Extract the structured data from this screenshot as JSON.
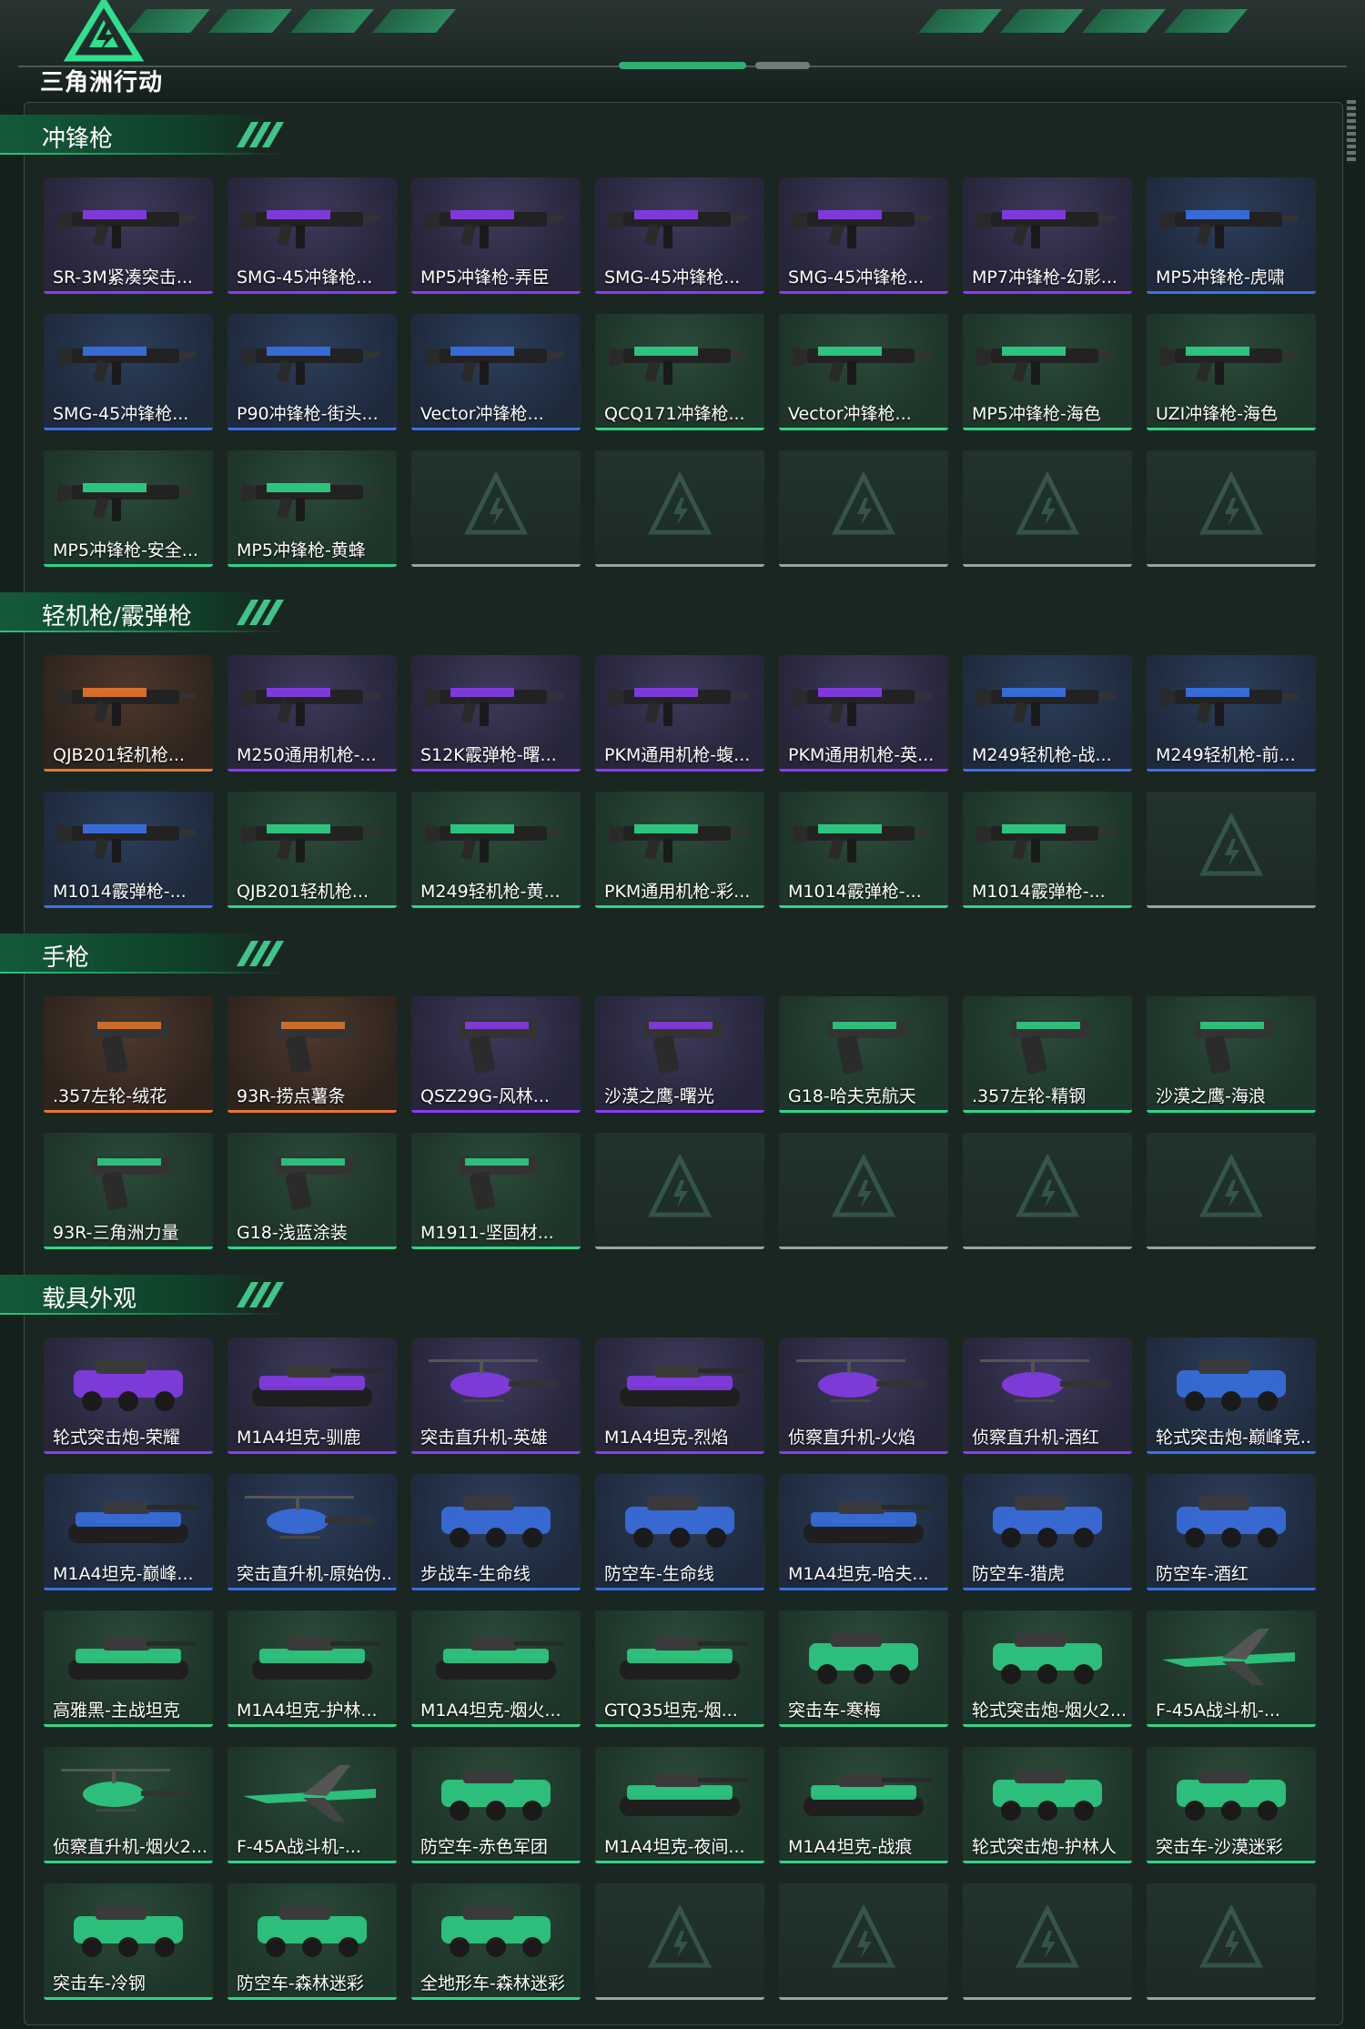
{
  "app": {
    "logo_text": "三角洲行动"
  },
  "colors": {
    "purple": "#8a3cf0",
    "blue": "#3a72e8",
    "green": "#2ed587",
    "orange": "#e8772a",
    "empty": "#9aa39f"
  },
  "sections": [
    {
      "title": "冲锋枪",
      "items": [
        {
          "name": "SR-3M紧凑突击...",
          "rarity": "purple",
          "type": "gun"
        },
        {
          "name": "SMG-45冲锋枪...",
          "rarity": "purple",
          "type": "gun"
        },
        {
          "name": "MP5冲锋枪-弄臣",
          "rarity": "purple",
          "type": "gun"
        },
        {
          "name": "SMG-45冲锋枪...",
          "rarity": "purple",
          "type": "gun"
        },
        {
          "name": "SMG-45冲锋枪...",
          "rarity": "purple",
          "type": "gun"
        },
        {
          "name": "MP7冲锋枪-幻影...",
          "rarity": "purple",
          "type": "gun"
        },
        {
          "name": "MP5冲锋枪-虎啸",
          "rarity": "blue",
          "type": "gun"
        },
        {
          "name": "SMG-45冲锋枪...",
          "rarity": "blue",
          "type": "gun"
        },
        {
          "name": "P90冲锋枪-街头...",
          "rarity": "blue",
          "type": "gun"
        },
        {
          "name": "Vector冲锋枪...",
          "rarity": "blue",
          "type": "gun"
        },
        {
          "name": "QCQ171冲锋枪...",
          "rarity": "green",
          "type": "gun"
        },
        {
          "name": "Vector冲锋枪...",
          "rarity": "green",
          "type": "gun"
        },
        {
          "name": "MP5冲锋枪-海色",
          "rarity": "green",
          "type": "gun"
        },
        {
          "name": "UZI冲锋枪-海色",
          "rarity": "green",
          "type": "gun"
        },
        {
          "name": "MP5冲锋枪-安全...",
          "rarity": "green",
          "type": "gun"
        },
        {
          "name": "MP5冲锋枪-黄蜂",
          "rarity": "green",
          "type": "gun"
        },
        {
          "empty": true
        },
        {
          "empty": true
        },
        {
          "empty": true
        },
        {
          "empty": true
        },
        {
          "empty": true
        }
      ]
    },
    {
      "title": "轻机枪/霰弹枪",
      "items": [
        {
          "name": "QJB201轻机枪...",
          "rarity": "orange",
          "type": "gun"
        },
        {
          "name": "M250通用机枪-...",
          "rarity": "purple",
          "type": "gun"
        },
        {
          "name": "S12K霰弹枪-曙...",
          "rarity": "purple",
          "type": "gun"
        },
        {
          "name": "PKM通用机枪-蝮...",
          "rarity": "purple",
          "type": "gun"
        },
        {
          "name": "PKM通用机枪-英...",
          "rarity": "purple",
          "type": "gun"
        },
        {
          "name": "M249轻机枪-战...",
          "rarity": "blue",
          "type": "gun"
        },
        {
          "name": "M249轻机枪-前...",
          "rarity": "blue",
          "type": "gun"
        },
        {
          "name": "M1014霰弹枪-...",
          "rarity": "blue",
          "type": "gun"
        },
        {
          "name": "QJB201轻机枪...",
          "rarity": "green",
          "type": "gun"
        },
        {
          "name": "M249轻机枪-黄...",
          "rarity": "green",
          "type": "gun"
        },
        {
          "name": "PKM通用机枪-彩...",
          "rarity": "green",
          "type": "gun"
        },
        {
          "name": "M1014霰弹枪-...",
          "rarity": "green",
          "type": "gun"
        },
        {
          "name": "M1014霰弹枪-...",
          "rarity": "green",
          "type": "gun"
        },
        {
          "empty": true
        }
      ]
    },
    {
      "title": "手枪",
      "items": [
        {
          "name": ".357左轮-绒花",
          "rarity": "orange",
          "type": "pistol"
        },
        {
          "name": "93R-捞点薯条",
          "rarity": "orange",
          "type": "pistol"
        },
        {
          "name": "QSZ29G-风林...",
          "rarity": "purple",
          "type": "pistol"
        },
        {
          "name": "沙漠之鹰-曙光",
          "rarity": "purple",
          "type": "pistol"
        },
        {
          "name": "G18-哈夫克航天",
          "rarity": "green",
          "type": "pistol"
        },
        {
          "name": ".357左轮-精钢",
          "rarity": "green",
          "type": "pistol"
        },
        {
          "name": "沙漠之鹰-海浪",
          "rarity": "green",
          "type": "pistol"
        },
        {
          "name": "93R-三角洲力量",
          "rarity": "green",
          "type": "pistol"
        },
        {
          "name": "G18-浅蓝涂装",
          "rarity": "green",
          "type": "pistol"
        },
        {
          "name": "M1911-坚固材...",
          "rarity": "green",
          "type": "pistol"
        },
        {
          "empty": true
        },
        {
          "empty": true
        },
        {
          "empty": true
        },
        {
          "empty": true
        }
      ]
    },
    {
      "title": "载具外观",
      "items": [
        {
          "name": "轮式突击炮-荣耀",
          "rarity": "purple",
          "type": "vehicle"
        },
        {
          "name": "M1A4坦克-驯鹿",
          "rarity": "purple",
          "type": "tank"
        },
        {
          "name": "突击直升机-英雄",
          "rarity": "purple",
          "type": "heli"
        },
        {
          "name": "M1A4坦克-烈焰",
          "rarity": "purple",
          "type": "tank"
        },
        {
          "name": "侦察直升机-火焰",
          "rarity": "purple",
          "type": "heli"
        },
        {
          "name": "侦察直升机-酒红",
          "rarity": "purple",
          "type": "heli"
        },
        {
          "name": "轮式突击炮-巅峰竞...",
          "rarity": "blue",
          "type": "vehicle"
        },
        {
          "name": "M1A4坦克-巅峰...",
          "rarity": "blue",
          "type": "tank"
        },
        {
          "name": "突击直升机-原始伪...",
          "rarity": "blue",
          "type": "heli"
        },
        {
          "name": "步战车-生命线",
          "rarity": "blue",
          "type": "vehicle"
        },
        {
          "name": "防空车-生命线",
          "rarity": "blue",
          "type": "vehicle"
        },
        {
          "name": "M1A4坦克-哈夫...",
          "rarity": "blue",
          "type": "tank"
        },
        {
          "name": "防空车-猎虎",
          "rarity": "blue",
          "type": "vehicle"
        },
        {
          "name": "防空车-酒红",
          "rarity": "blue",
          "type": "vehicle"
        },
        {
          "name": "高雅黑-主战坦克",
          "rarity": "green",
          "type": "tank"
        },
        {
          "name": "M1A4坦克-护林...",
          "rarity": "green",
          "type": "tank"
        },
        {
          "name": "M1A4坦克-烟火...",
          "rarity": "green",
          "type": "tank"
        },
        {
          "name": "GTQ35坦克-烟...",
          "rarity": "green",
          "type": "tank"
        },
        {
          "name": "突击车-寒梅",
          "rarity": "green",
          "type": "vehicle"
        },
        {
          "name": "轮式突击炮-烟火2...",
          "rarity": "green",
          "type": "vehicle"
        },
        {
          "name": "F-45A战斗机-...",
          "rarity": "green",
          "type": "jet"
        },
        {
          "name": "侦察直升机-烟火2...",
          "rarity": "green",
          "type": "heli"
        },
        {
          "name": "F-45A战斗机-...",
          "rarity": "green",
          "type": "jet"
        },
        {
          "name": "防空车-赤色军团",
          "rarity": "green",
          "type": "vehicle"
        },
        {
          "name": "M1A4坦克-夜间...",
          "rarity": "green",
          "type": "tank"
        },
        {
          "name": "M1A4坦克-战痕",
          "rarity": "green",
          "type": "tank"
        },
        {
          "name": "轮式突击炮-护林人",
          "rarity": "green",
          "type": "vehicle"
        },
        {
          "name": "突击车-沙漠迷彩",
          "rarity": "green",
          "type": "vehicle"
        },
        {
          "name": "突击车-冷钢",
          "rarity": "green",
          "type": "vehicle"
        },
        {
          "name": "防空车-森林迷彩",
          "rarity": "green",
          "type": "vehicle"
        },
        {
          "name": "全地形车-森林迷彩",
          "rarity": "green",
          "type": "vehicle"
        },
        {
          "empty": true
        },
        {
          "empty": true
        },
        {
          "empty": true
        },
        {
          "empty": true
        }
      ]
    }
  ]
}
